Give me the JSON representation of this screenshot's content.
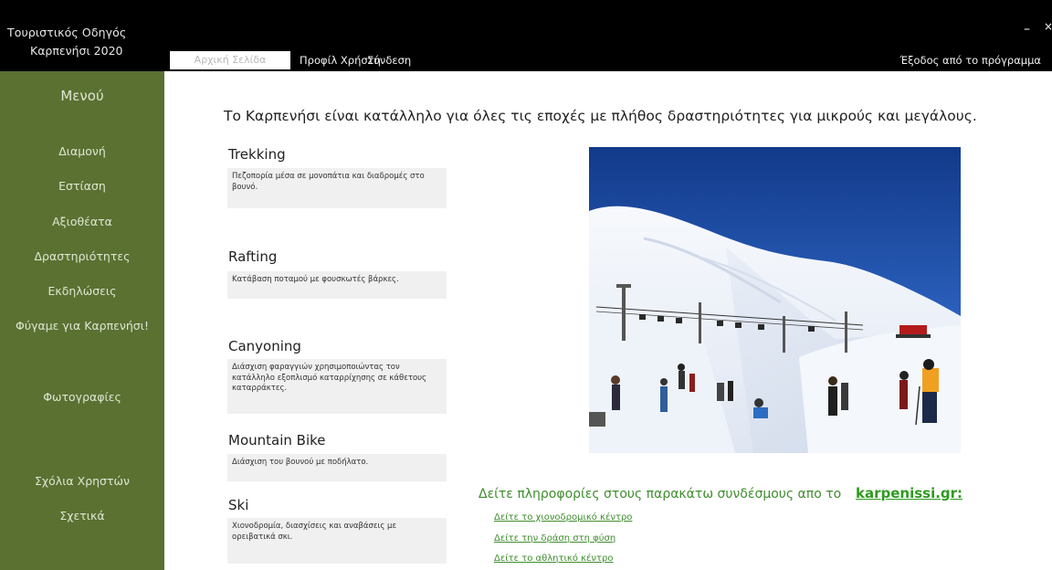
{
  "app": {
    "title_line1": "Τουριστικός Οδηγός",
    "title_line2": "Καρπενήσι 2020",
    "minimize": "–",
    "close": "×"
  },
  "tabs": {
    "home": "Αρχική Σελίδα",
    "profile": "Προφίλ Χρήστη",
    "login": "Σύνδεση",
    "exit": "Έξοδος από το πρόγραμμα"
  },
  "sidebar": {
    "title": "Μενού",
    "items": [
      "Διαμονή",
      "Εστίαση",
      "Αξιοθέατα",
      "Δραστηριότητες",
      "Εκδηλώσεις",
      "Φύγαμε για Καρπενήσι!",
      "Φωτογραφίες",
      "Σχόλια Χρηστών",
      "Σχετικά"
    ]
  },
  "content": {
    "intro": "Το Καρπενήσι είναι κατάλληλο για όλες τις εποχές με πλήθος δραστηριότητες για μικρούς και μεγάλους.",
    "activities": [
      {
        "title": "Trekking",
        "text": "Πεζοπορία μέσα σε μονοπάτια και διαδρομές στο βουνό."
      },
      {
        "title": "Rafting",
        "text": "Κατάβαση ποταμού με φουσκωτές βάρκες."
      },
      {
        "title": "Canyoning",
        "text": "Διάσχιση φαραγγιών χρησιμοποιώντας τον κατάλληλο εξοπλισμό καταρρίχησης σε κάθετους καταρράκτες."
      },
      {
        "title": "Mountain Bike",
        "text": "Διάσχιση του βουνού με ποδήλατο."
      },
      {
        "title": "Ski",
        "text": "Χιονοδρομία, διασχίσεις και αναβάσεις με ορειβατικά σκι."
      }
    ],
    "links_heading": "Δείτε πληροφορίες στους παρακάτω συνδέσμους απο το",
    "links_site": "karpenissi.gr:",
    "links": [
      "Δείτε το χιονοδρομικό κέντρο",
      "Δείτε την δράση στη φύση",
      "Δείτε το αθλητικό κέντρο"
    ]
  },
  "colors": {
    "sidebar_bg": "#5a7132",
    "topbar_bg": "#000000",
    "link_green": "#3f8d2e"
  }
}
